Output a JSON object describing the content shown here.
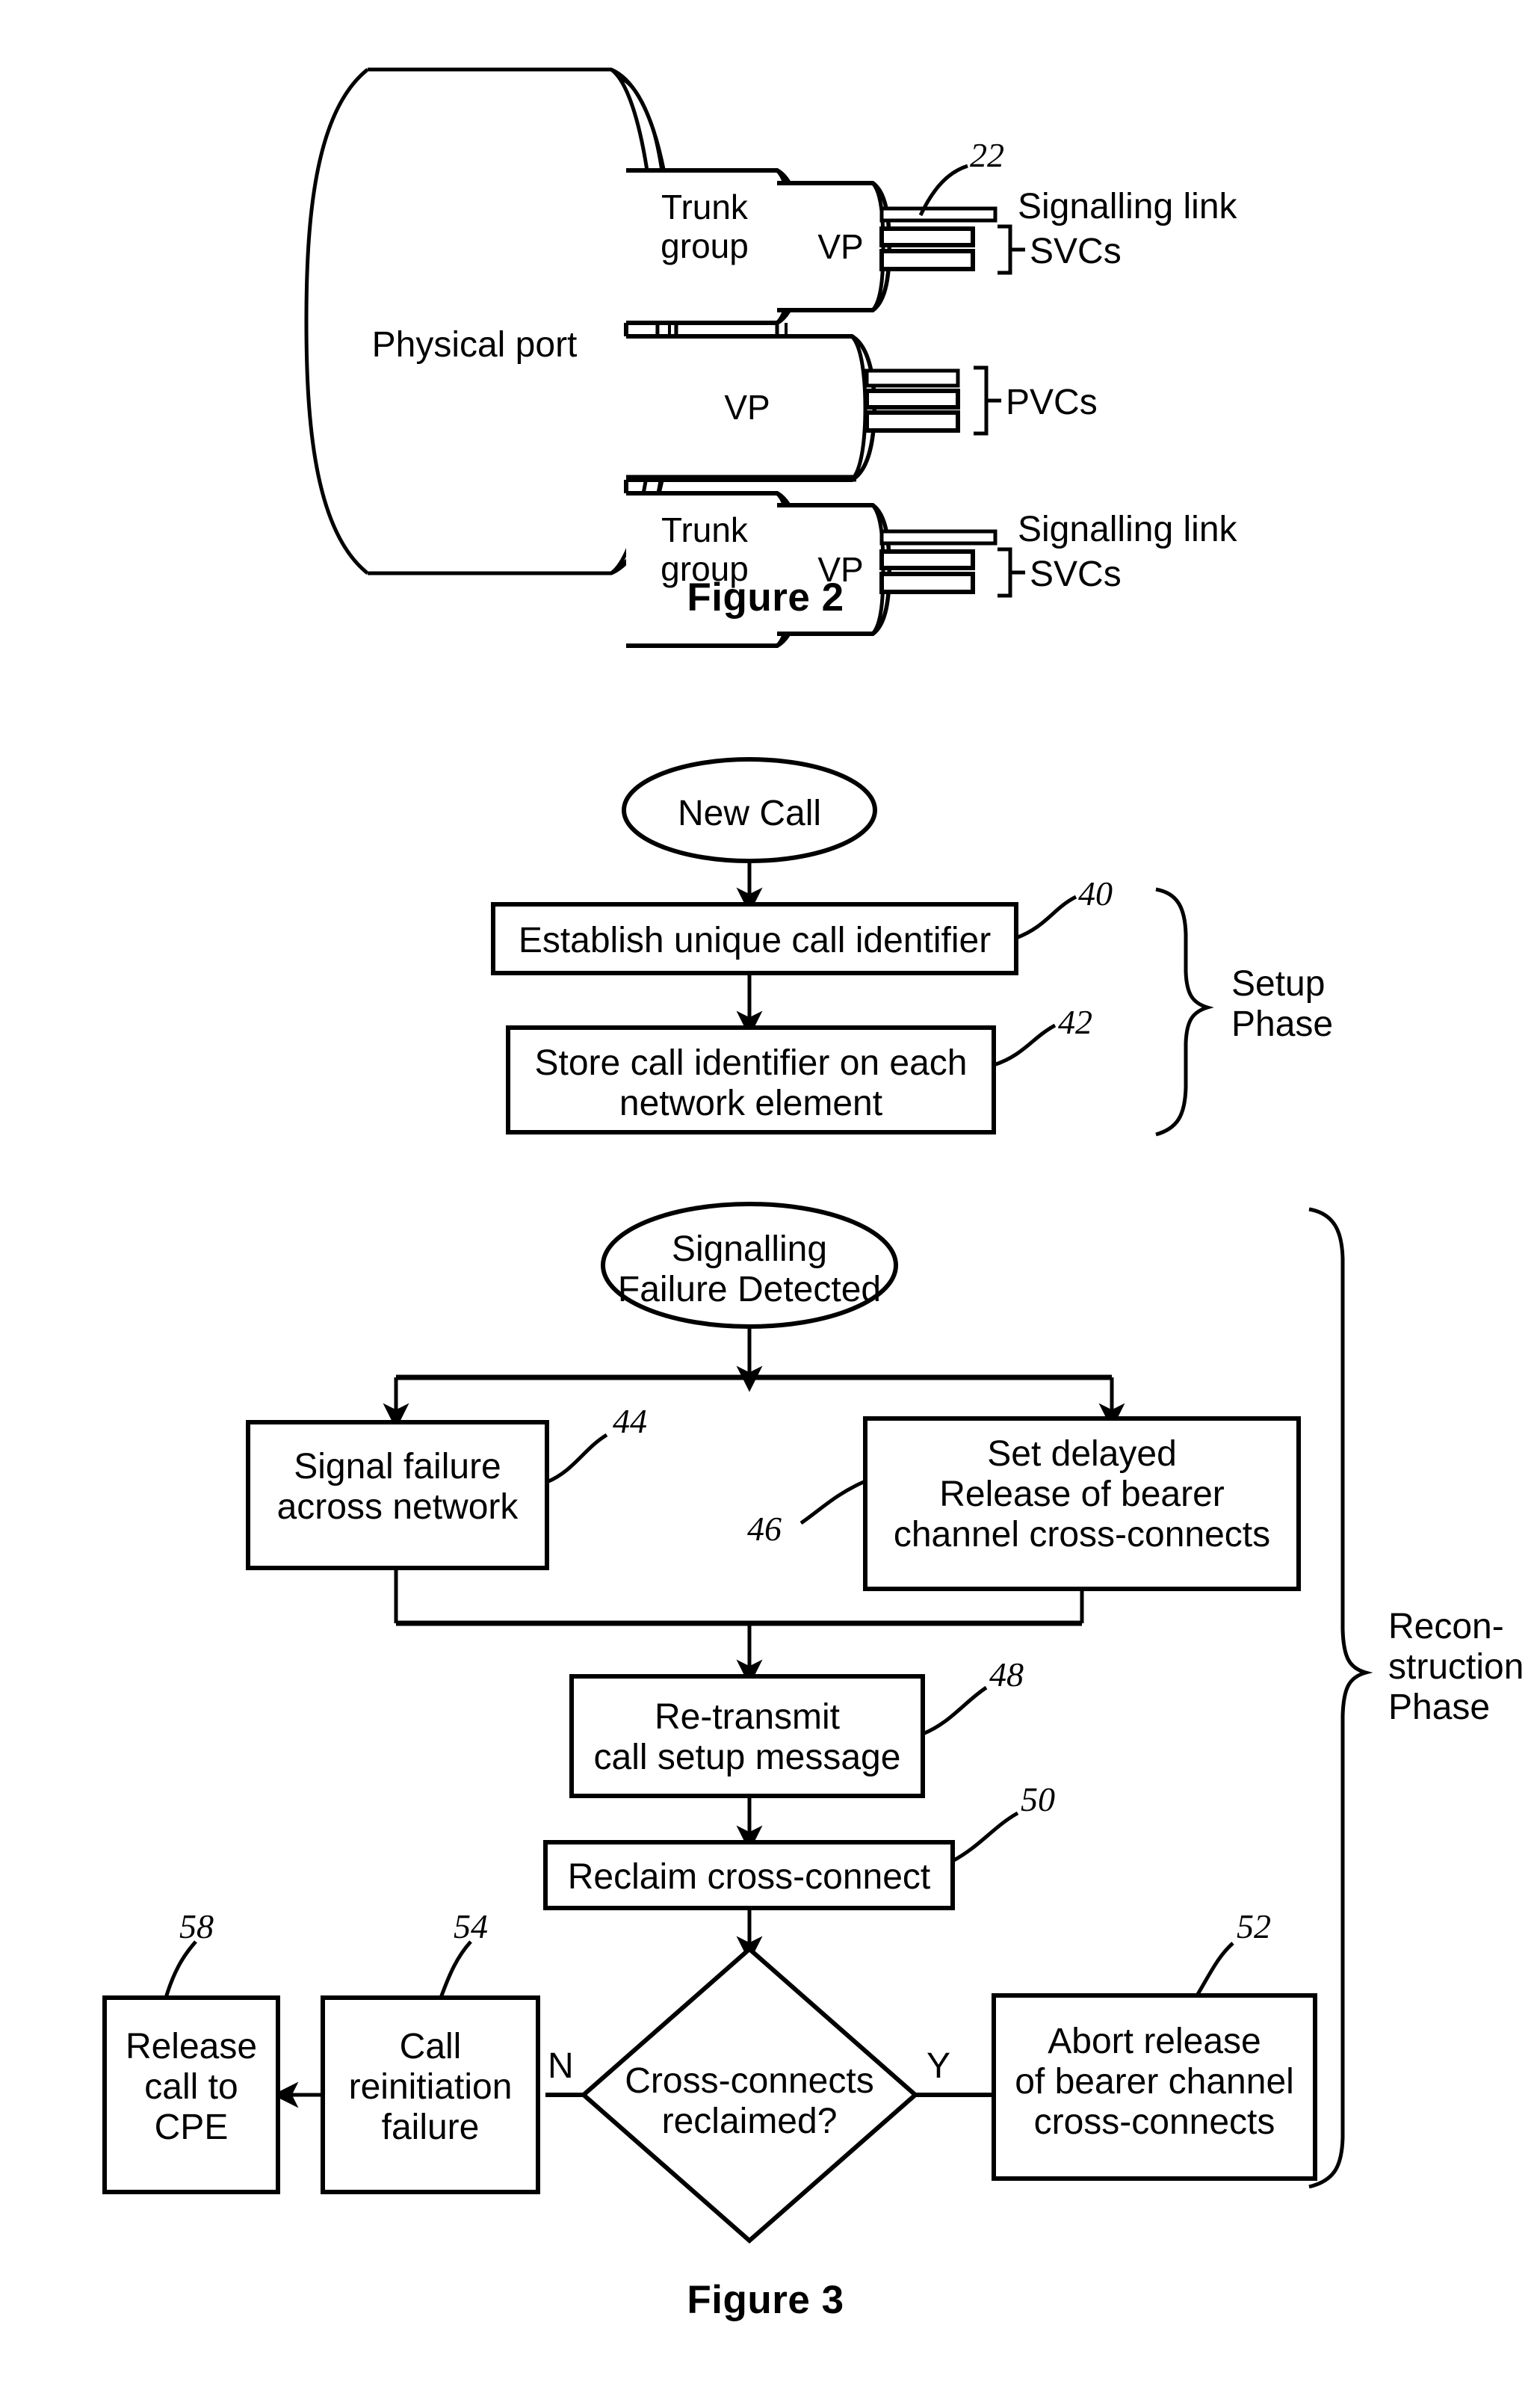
{
  "document": {
    "type": "patent-drawing-sheet",
    "figures": [
      {
        "id": "figure-2",
        "caption": "Figure 2",
        "reference_numbers": [
          "22"
        ],
        "labels": {
          "physical_port": "Physical port",
          "trunk_group": "Trunk group",
          "vp": "VP",
          "signalling_link": "Signalling link",
          "svcs": "SVCs",
          "pvcs": "PVCs"
        },
        "rows": [
          {
            "container": "Trunk group",
            "vp": "VP",
            "outputs": [
              "Signalling link",
              "SVCs"
            ],
            "ref": "22"
          },
          {
            "container": "",
            "vp": "VP",
            "outputs": [
              "PVCs"
            ],
            "ref": ""
          },
          {
            "container": "Trunk group",
            "vp": "VP",
            "outputs": [
              "Signalling link",
              "SVCs"
            ],
            "ref": ""
          }
        ]
      },
      {
        "id": "figure-3",
        "caption": "Figure 3",
        "phases": [
          {
            "name": "Setup Phase",
            "line1": "Setup",
            "line2": "Phase"
          },
          {
            "name": "Reconstruction Phase",
            "line1": "Recon-",
            "line2": "struction",
            "line3": "Phase"
          }
        ],
        "nodes": [
          {
            "id": "new-call",
            "shape": "oval",
            "text": "New Call",
            "ref": ""
          },
          {
            "id": "establish-id",
            "shape": "process",
            "text": "Establish unique call identifier",
            "ref": "40"
          },
          {
            "id": "store-id",
            "shape": "process",
            "line1": "Store call identifier on each",
            "line2": "network element",
            "ref": "42"
          },
          {
            "id": "signalling-failure",
            "shape": "oval",
            "line1": "Signalling",
            "line2": "Failure Detected",
            "ref": ""
          },
          {
            "id": "signal-failure",
            "shape": "process",
            "line1": "Signal failure",
            "line2": "across network",
            "ref": "44"
          },
          {
            "id": "set-delayed",
            "shape": "process",
            "line1": "Set delayed",
            "line2": "Release of bearer",
            "line3": "channel cross-connects",
            "ref": "46"
          },
          {
            "id": "retransmit",
            "shape": "process",
            "line1": "Re-transmit",
            "line2": "call setup message",
            "ref": "48"
          },
          {
            "id": "reclaim",
            "shape": "process",
            "text": "Reclaim cross-connect",
            "ref": "50"
          },
          {
            "id": "decision",
            "shape": "diamond",
            "line1": "Cross-connects",
            "line2": "reclaimed?",
            "ref": ""
          },
          {
            "id": "abort-release",
            "shape": "process",
            "line1": "Abort release",
            "line2": "of bearer channel",
            "line3": "cross-connects",
            "ref": "52"
          },
          {
            "id": "call-reinit-fail",
            "shape": "process",
            "line1": "Call",
            "line2": "reinitiation",
            "line3": "failure",
            "ref": "54"
          },
          {
            "id": "release-cpe",
            "shape": "process",
            "line1": "Release",
            "line2": "call to",
            "line3": "CPE",
            "ref": "58"
          }
        ],
        "branch_labels": {
          "no": "N",
          "yes": "Y"
        }
      }
    ]
  },
  "colors": {
    "ink": "#000000",
    "paper": "#ffffff"
  }
}
